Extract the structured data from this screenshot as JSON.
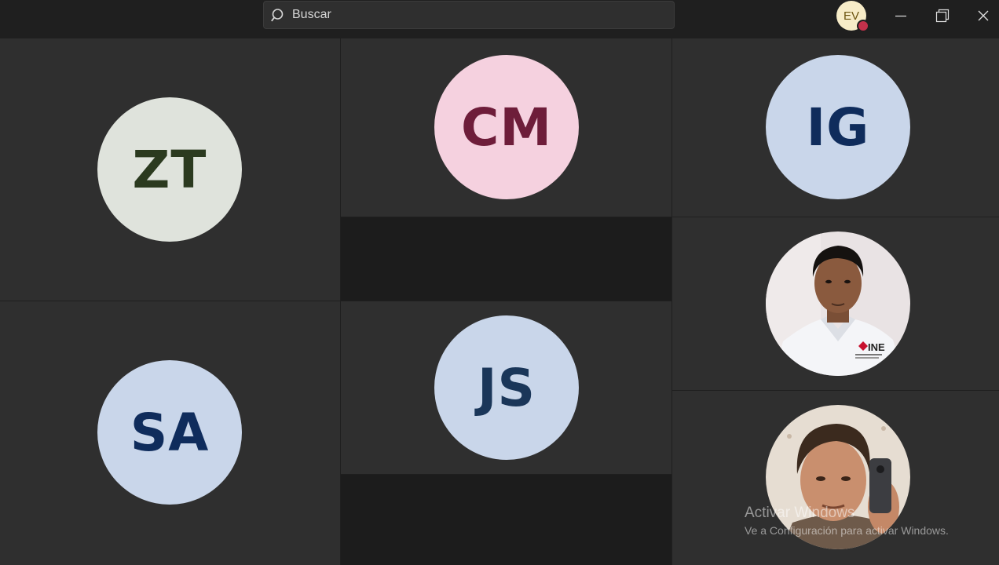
{
  "search": {
    "placeholder": "Buscar"
  },
  "account": {
    "initials": "EV",
    "avatar_color": "#f7ecc8",
    "status_color": "#c4314b"
  },
  "window_controls": [
    "minimize",
    "restore",
    "close"
  ],
  "participants": [
    {
      "initials": "ZT",
      "circle_color": "#dfe3dc",
      "text_color": "#2b3a1f"
    },
    {
      "initials": "CM",
      "circle_color": "#f5d1df",
      "text_color": "#6e1d3a"
    },
    {
      "initials": "IG",
      "circle_color": "#c9d6ea",
      "text_color": "#0f2c5c"
    },
    {
      "initials": "SA",
      "circle_color": "#c9d6ea",
      "text_color": "#0f2c5c"
    },
    {
      "initials": "JS",
      "circle_color": "#c9d6ea",
      "text_color": "#1a3659"
    }
  ],
  "photo_participants": [
    {
      "icon": "man-white-shirt-ine-logo",
      "logo_text": "INE"
    },
    {
      "icon": "man-holding-phone-selfie"
    }
  ],
  "watermark": {
    "title": "Activar Windows",
    "subtitle": "Ve a Configuración para activar Windows."
  }
}
